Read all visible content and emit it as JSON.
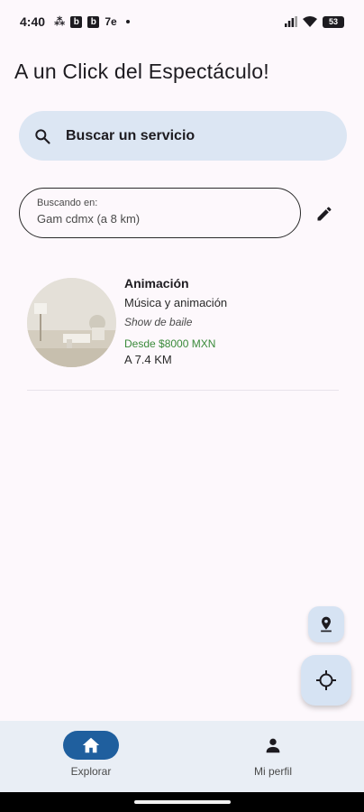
{
  "status": {
    "time": "4:40",
    "battery": "53",
    "notification_icons": [
      "teams-icon",
      "b-icon",
      "b-icon",
      "7e-icon"
    ]
  },
  "header": {
    "title": "A un Click del Espectáculo!"
  },
  "search": {
    "label": "Buscar un servicio"
  },
  "location": {
    "label": "Buscando en:",
    "value": "Gam cdmx (a 8 km)"
  },
  "services": [
    {
      "title": "Animación",
      "category": "Música y animación",
      "subtitle": "Show de baile",
      "price": "Desde $8000 MXN",
      "distance": "A 7.4 KM"
    }
  ],
  "nav": {
    "items": [
      {
        "label": "Explorar",
        "icon": "home-icon",
        "active": true
      },
      {
        "label": "Mi perfil",
        "icon": "person-icon",
        "active": false
      }
    ]
  },
  "colors": {
    "background": "#fdf8fc",
    "search_bg": "#dce6f3",
    "nav_active": "#1f5f9e",
    "price_green": "#3a8a3a",
    "nav_bg": "#e9eef5"
  }
}
